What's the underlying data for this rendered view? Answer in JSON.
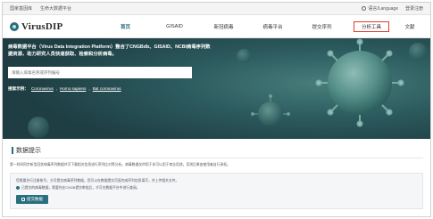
{
  "topbar": {
    "left_links": [
      "国家基因库",
      "生命大数据平台"
    ],
    "right_links": [
      "语言/Language",
      "登录注册"
    ]
  },
  "header": {
    "logo_text": "VirusDIP",
    "nav": [
      {
        "label": "首页",
        "state": "active"
      },
      {
        "label": "GISAID",
        "state": ""
      },
      {
        "label": "新冠病毒",
        "state": ""
      },
      {
        "label": "病毒平台",
        "state": ""
      },
      {
        "label": "提交序列",
        "state": ""
      },
      {
        "label": "分析工具",
        "state": "highlight"
      },
      {
        "label": "文献",
        "state": ""
      }
    ]
  },
  "hero": {
    "description": "病毒数据平台（Virus Data Integration Platform）整合了CNGBdb、GISAID、NCBI病毒序列数据资源，助力研究人员快速获取、检索和分析病毒。",
    "search_placeholder": "请输入病毒名称或序列编号",
    "examples_label": "搜索示例：",
    "examples": [
      "Coronavirus",
      "Homo sapiens",
      "Bat coronavirus"
    ]
  },
  "notice": {
    "title": "数据提示",
    "text": "第一时间同步新型冠状病毒序列数据并可下载相关信息进行序列比对等分析。病毒数据仅供用于非可以用于商业用途，否则后果由使用者自行承担。",
    "info_lines": [
      "您需要先行注册账号，方可提交病毒序列数据。您可以在数据提交页面完成序列信息填写，并上传相关文件。",
      "已提交的病毒数据，需要先在CNGB提交审批后，才可在数据平台中进行查阅。"
    ],
    "submit_label": "提交数据"
  },
  "colors": {
    "accent": "#2a6f7f",
    "highlight_border": "#e23b2e",
    "hero_bg": "#2f5a5f"
  }
}
